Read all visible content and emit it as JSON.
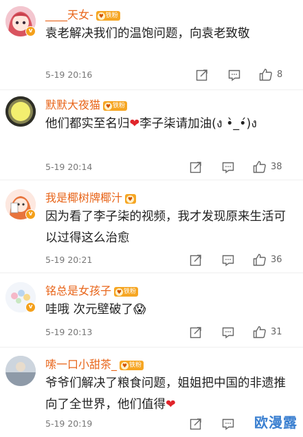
{
  "comments": [
    {
      "user": "____天女-",
      "badge": "铁粉",
      "text": "袁老解决我们的温饱问题，向袁老致敬",
      "time": "5-19 20:16",
      "likes": "8",
      "avatar_color": "#f1b7c3"
    },
    {
      "user": "默默大夜猫",
      "badge": "铁粉",
      "text_before": "他们都实至名归",
      "text_after": "李子柒请加油(ง •̀_•́)ง",
      "time": "5-19 20:14",
      "likes": "38",
      "avatar_color": "#f5ef63"
    },
    {
      "user": "我是椰树牌椰汁",
      "badge": "",
      "text": "因为看了李子柒的视频，我才发现原来生活可以过得这么治愈",
      "time": "5-19 20:21",
      "likes": "36",
      "avatar_color": "#f7d1c5"
    },
    {
      "user": "铭总是女孩子",
      "badge": "铁粉",
      "text": "哇哦 次元壁破了",
      "emoji": "😱",
      "time": "5-19 20:13",
      "likes": "31",
      "avatar_color": "#e6eef6"
    },
    {
      "user": "嗦一口小甜茶_",
      "badge": "铁粉",
      "text": "爷爷们解决了粮食问题，姐姐把中国的非遗推向了全世界，他们值得",
      "time": "5-19 20:19",
      "likes": "",
      "avatar_color": "#b9c2cc"
    }
  ],
  "watermark": "欧漫露",
  "colors": {
    "name": "#e8651a",
    "badge": "#f6a623",
    "heart": "#e0242a",
    "watermark": "#3a7fd0"
  }
}
